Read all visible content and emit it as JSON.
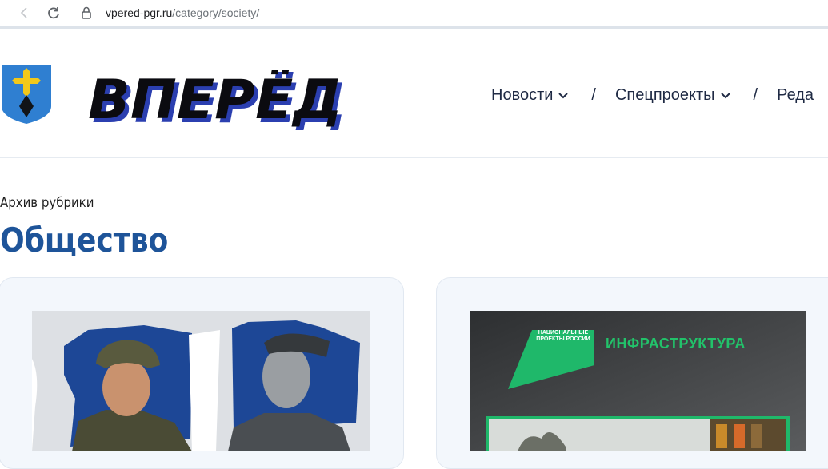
{
  "browser": {
    "url_domain": "vpered-pgr.ru",
    "url_path": "/category/society/"
  },
  "header": {
    "logo_text": "ВПЕРЁД",
    "menu": [
      {
        "label": "Новости"
      },
      {
        "label": "Спецпроекты"
      },
      {
        "label": "Реда"
      }
    ],
    "separator": "/"
  },
  "page": {
    "archive_label": "Архив рубрики",
    "title": "Общество"
  },
  "cards": {
    "right_banner": {
      "badge_text": "НАЦИОНАЛЬНЫЕ ПРОЕКТЫ РОССИИ",
      "heading": "ИНФРАСТРУКТУРА"
    }
  },
  "colors": {
    "title": "#1e5499",
    "menu_text": "#1f2a44",
    "banner_green": "#22c26a"
  }
}
